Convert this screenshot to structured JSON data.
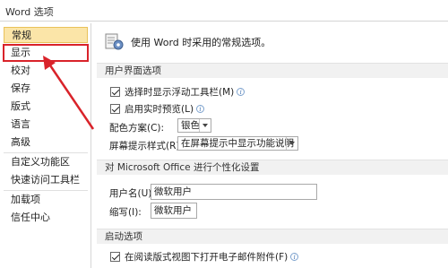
{
  "window": {
    "title": "Word 选项"
  },
  "sidebar": {
    "items": [
      {
        "label": "常规"
      },
      {
        "label": "显示"
      },
      {
        "label": "校对"
      },
      {
        "label": "保存"
      },
      {
        "label": "版式"
      },
      {
        "label": "语言"
      },
      {
        "label": "高级"
      },
      {
        "label": "自定义功能区"
      },
      {
        "label": "快速访问工具栏"
      },
      {
        "label": "加载项"
      },
      {
        "label": "信任中心"
      }
    ]
  },
  "main": {
    "intro": "使用 Word 时采用的常规选项。",
    "ui_section": {
      "header": "用户界面选项",
      "show_mini_toolbar": "选择时显示浮动工具栏(M)",
      "live_preview": "启用实时预览(L)",
      "color_scheme_label": "配色方案(C):",
      "color_scheme_value": "银色",
      "screentip_label": "屏幕提示样式(R):",
      "screentip_value": "在屏幕提示中显示功能说明"
    },
    "personalize_section": {
      "header": "对 Microsoft Office 进行个性化设置",
      "username_label": "用户名(U):",
      "username_value": "微软用户",
      "initials_label": "缩写(I):",
      "initials_value": "微软用户"
    },
    "startup_section": {
      "header": "启动选项",
      "open_email_reading": "在阅读版式视图下打开电子邮件附件(F)"
    }
  },
  "colors": {
    "selected_bg": "#fbe5a8",
    "highlight_box": "#d9232a"
  }
}
